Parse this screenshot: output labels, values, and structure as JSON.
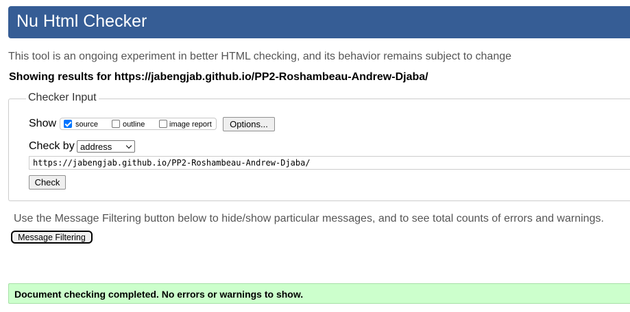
{
  "header": {
    "title": "Nu Html Checker"
  },
  "intro": "This tool is an ongoing experiment in better HTML checking, and its behavior remains subject to change",
  "showing_results": "Showing results for https://jabengjab.github.io/PP2-Roshambeau-Andrew-Djaba/",
  "checker_input": {
    "legend": "Checker Input",
    "show_label": "Show",
    "show_options": [
      {
        "label": "source",
        "checked": true
      },
      {
        "label": "outline",
        "checked": false
      },
      {
        "label": "image report",
        "checked": false
      }
    ],
    "options_button": "Options...",
    "check_by_label": "Check by",
    "check_by_value": "address",
    "url_value": "https://jabengjab.github.io/PP2-Roshambeau-Andrew-Djaba/",
    "check_button": "Check"
  },
  "filtering": {
    "text": "Use the Message Filtering button below to hide/show particular messages, and to see total counts of errors and warnings.",
    "button": "Message Filtering"
  },
  "result": {
    "message": "Document checking completed. No errors or warnings to show.",
    "color": "#ccffcc"
  },
  "colors": {
    "header": "#365d95"
  }
}
